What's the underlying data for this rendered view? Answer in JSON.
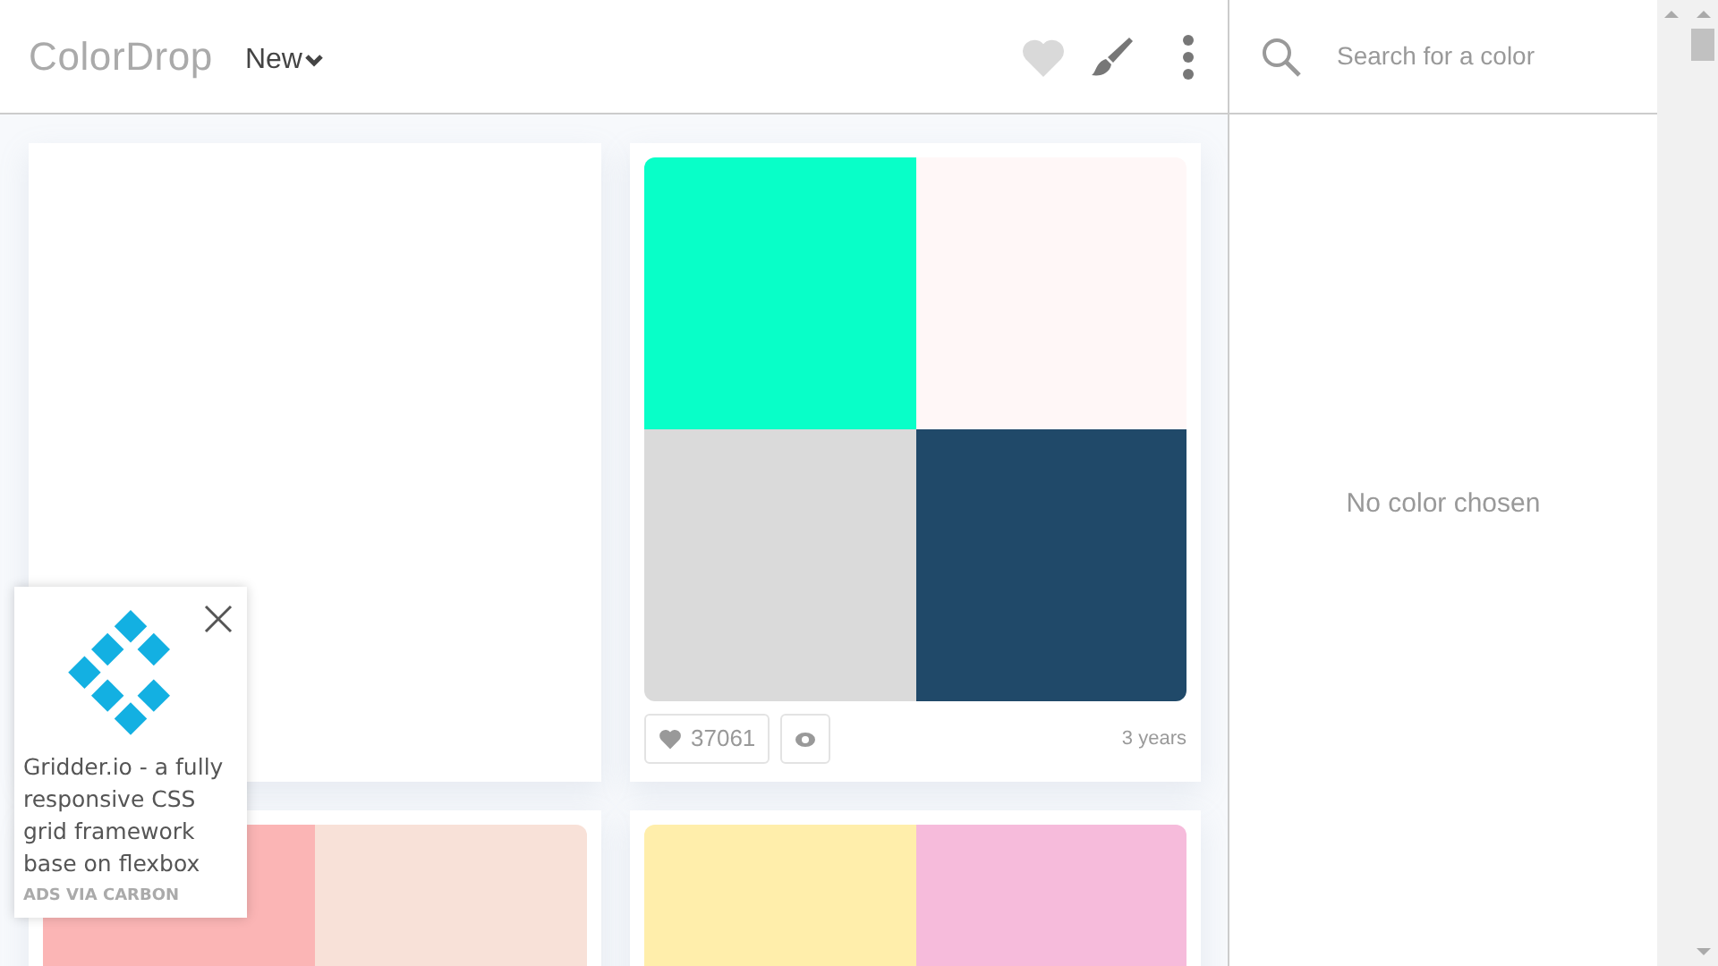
{
  "header": {
    "logo": "ColorDrop",
    "sort_menu": "New"
  },
  "search": {
    "placeholder": "Search for a color"
  },
  "sidebar": {
    "message": "No color chosen"
  },
  "palettes": [
    {
      "kind": "blank"
    },
    {
      "kind": "palette",
      "colors": [
        {
          "color": "#08ffc8"
        },
        {
          "color": "#fff7f7"
        },
        {
          "color": "#dadada"
        },
        {
          "color": "#204969"
        }
      ],
      "likes": "37061",
      "age": "3 years"
    },
    {
      "kind": "palette",
      "colors": [
        {
          "color": "#fbb5b5"
        },
        {
          "color": "#f8e1d8"
        }
      ]
    },
    {
      "kind": "palette",
      "colors": [
        {
          "color": "#ffeeab"
        },
        {
          "color": "#f6bbdb"
        }
      ]
    }
  ],
  "ad": {
    "text": "Gridder.io - a fully responsive CSS grid framework base on flexbox",
    "label": "ADS VIA CARBON"
  }
}
